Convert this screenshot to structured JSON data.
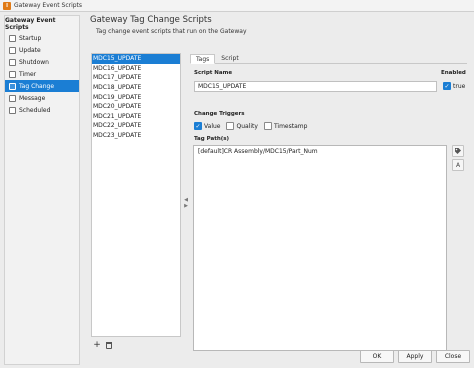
{
  "window": {
    "title": "Gateway Event Scripts",
    "icon": "ignition-logo-icon"
  },
  "sidebar": {
    "header": "Gateway Event Scripts",
    "items": [
      {
        "label": "Startup",
        "icon": "startup-icon",
        "active": false
      },
      {
        "label": "Update",
        "icon": "update-icon",
        "active": false
      },
      {
        "label": "Shutdown",
        "icon": "shutdown-icon",
        "active": false
      },
      {
        "label": "Timer",
        "icon": "timer-icon",
        "active": false
      },
      {
        "label": "Tag Change",
        "icon": "tag-change-icon",
        "active": true
      },
      {
        "label": "Message",
        "icon": "message-icon",
        "active": false
      },
      {
        "label": "Scheduled",
        "icon": "scheduled-icon",
        "active": false
      }
    ]
  },
  "main": {
    "title": "Gateway Tag Change Scripts",
    "subtitle": "Tag change event scripts that run on the Gateway"
  },
  "scripts": {
    "items": [
      "MDC15_UPDATE",
      "MDC16_UPDATE",
      "MDC17_UPDATE",
      "MDC18_UPDATE",
      "MDC19_UPDATE",
      "MDC20_UPDATE",
      "MDC21_UPDATE",
      "MDC22_UPDATE",
      "MDC23_UPDATE"
    ],
    "selected": "MDC15_UPDATE",
    "add_symbol": "+"
  },
  "tabs": [
    {
      "label": "Tags",
      "active": true
    },
    {
      "label": "Script",
      "active": false
    }
  ],
  "editor": {
    "script_name_label": "Script Name",
    "script_name_value": "MDC15_UPDATE",
    "enabled_label": "Enabled",
    "enabled_value": "true",
    "change_triggers_label": "Change Triggers",
    "triggers": [
      {
        "label": "Value",
        "checked": true
      },
      {
        "label": "Quality",
        "checked": false
      },
      {
        "label": "Timestamp",
        "checked": false
      }
    ],
    "tag_paths_label": "Tag Path(s)",
    "tag_paths_value": "[default]CR Assembly/MDC15/Part_Num",
    "tool_tag_icon": "tag-icon",
    "tool_spell_icon": "spellcheck-icon",
    "tool_spell_glyph": "A"
  },
  "buttons": {
    "ok": "OK",
    "apply": "Apply",
    "close": "Close"
  },
  "colors": {
    "selection": "#1b7ed4",
    "brand": "#e07a16"
  }
}
